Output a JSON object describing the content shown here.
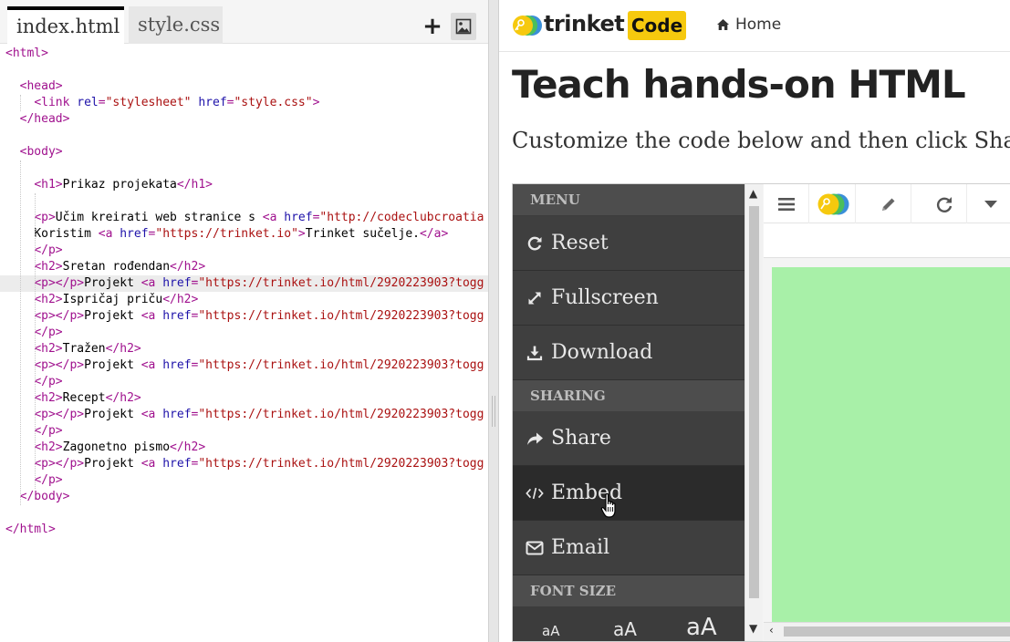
{
  "editor": {
    "tabs": [
      {
        "label": "index.html",
        "active": true
      },
      {
        "label": "style.css",
        "active": false
      }
    ],
    "add_file_icon": "plus-icon",
    "image_icon": "image-icon"
  },
  "code": {
    "lines": [
      [
        [
          "tg",
          "<html>"
        ]
      ],
      [],
      [
        [
          "tx",
          "  "
        ],
        [
          "tg",
          "<head>"
        ]
      ],
      [
        [
          "tx",
          "    "
        ],
        [
          "tg",
          "<link "
        ],
        [
          "at",
          "rel"
        ],
        [
          "tg",
          "="
        ],
        [
          "st",
          "\"stylesheet\""
        ],
        [
          "tx",
          " "
        ],
        [
          "at",
          "href"
        ],
        [
          "tg",
          "="
        ],
        [
          "st",
          "\"style.css\""
        ],
        [
          "tg",
          ">"
        ]
      ],
      [
        [
          "tx",
          "  "
        ],
        [
          "tg",
          "</head>"
        ]
      ],
      [],
      [
        [
          "tx",
          "  "
        ],
        [
          "tg",
          "<body>"
        ]
      ],
      [],
      [
        [
          "tx",
          "    "
        ],
        [
          "tg",
          "<h1>"
        ],
        [
          "tx",
          "Prikaz projekata"
        ],
        [
          "tg",
          "</h1>"
        ]
      ],
      [],
      [
        [
          "tx",
          "    "
        ],
        [
          "tg",
          "<p>"
        ],
        [
          "tx",
          "Učim kreirati web stranice s "
        ],
        [
          "tg",
          "<a "
        ],
        [
          "at",
          "href"
        ],
        [
          "tg",
          "="
        ],
        [
          "st",
          "\"http://codeclubcroatia"
        ]
      ],
      [
        [
          "tx",
          "    Koristim "
        ],
        [
          "tg",
          "<a "
        ],
        [
          "at",
          "href"
        ],
        [
          "tg",
          "="
        ],
        [
          "st",
          "\"https://trinket.io\""
        ],
        [
          "tg",
          ">"
        ],
        [
          "tx",
          "Trinket sučelje."
        ],
        [
          "tg",
          "</a>"
        ]
      ],
      [
        [
          "tx",
          "    "
        ],
        [
          "tg",
          "</p>"
        ]
      ],
      [
        [
          "tx",
          "    "
        ],
        [
          "tg",
          "<h2>"
        ],
        [
          "tx",
          "Sretan rođendan"
        ],
        [
          "tg",
          "</h2>"
        ]
      ],
      [
        [
          "tx",
          "    "
        ],
        [
          "tg",
          "<p></p>"
        ],
        [
          "tx",
          "Projekt "
        ],
        [
          "tg",
          "<a "
        ],
        [
          "at",
          "href"
        ],
        [
          "tg",
          "="
        ],
        [
          "st",
          "\"https://trinket.io/html/2920223903?togg"
        ]
      ],
      [
        [
          "tx",
          "    "
        ],
        [
          "tg",
          "<h2>"
        ],
        [
          "tx",
          "Ispričaj priču"
        ],
        [
          "tg",
          "</h2>"
        ]
      ],
      [
        [
          "tx",
          "    "
        ],
        [
          "tg",
          "<p></p>"
        ],
        [
          "tx",
          "Projekt "
        ],
        [
          "tg",
          "<a "
        ],
        [
          "at",
          "href"
        ],
        [
          "tg",
          "="
        ],
        [
          "st",
          "\"https://trinket.io/html/2920223903?togg"
        ]
      ],
      [
        [
          "tx",
          "    "
        ],
        [
          "tg",
          "</p>"
        ]
      ],
      [
        [
          "tx",
          "    "
        ],
        [
          "tg",
          "<h2>"
        ],
        [
          "tx",
          "Tražen"
        ],
        [
          "tg",
          "</h2>"
        ]
      ],
      [
        [
          "tx",
          "    "
        ],
        [
          "tg",
          "<p></p>"
        ],
        [
          "tx",
          "Projekt "
        ],
        [
          "tg",
          "<a "
        ],
        [
          "at",
          "href"
        ],
        [
          "tg",
          "="
        ],
        [
          "st",
          "\"https://trinket.io/html/2920223903?togg"
        ]
      ],
      [
        [
          "tx",
          "    "
        ],
        [
          "tg",
          "</p>"
        ]
      ],
      [
        [
          "tx",
          "    "
        ],
        [
          "tg",
          "<h2>"
        ],
        [
          "tx",
          "Recept"
        ],
        [
          "tg",
          "</h2>"
        ]
      ],
      [
        [
          "tx",
          "    "
        ],
        [
          "tg",
          "<p></p>"
        ],
        [
          "tx",
          "Projekt "
        ],
        [
          "tg",
          "<a "
        ],
        [
          "at",
          "href"
        ],
        [
          "tg",
          "="
        ],
        [
          "st",
          "\"https://trinket.io/html/2920223903?togg"
        ]
      ],
      [
        [
          "tx",
          "    "
        ],
        [
          "tg",
          "</p>"
        ]
      ],
      [
        [
          "tx",
          "    "
        ],
        [
          "tg",
          "<h2>"
        ],
        [
          "tx",
          "Zagonetno pismo"
        ],
        [
          "tg",
          "</h2>"
        ]
      ],
      [
        [
          "tx",
          "    "
        ],
        [
          "tg",
          "<p></p>"
        ],
        [
          "tx",
          "Projekt "
        ],
        [
          "tg",
          "<a "
        ],
        [
          "at",
          "href"
        ],
        [
          "tg",
          "="
        ],
        [
          "st",
          "\"https://trinket.io/html/2920223903?togg"
        ]
      ],
      [
        [
          "tx",
          "    "
        ],
        [
          "tg",
          "</p>"
        ]
      ],
      [
        [
          "tx",
          "  "
        ],
        [
          "tg",
          "</body>"
        ]
      ],
      [],
      [
        [
          "tg",
          "</html>"
        ]
      ]
    ],
    "current_line": 14
  },
  "preview": {
    "brand": "trinket",
    "badge": "Code",
    "home_label": "Home",
    "home_icon": "home-icon",
    "heading": "Teach hands-on HTML",
    "subheading": "Customize the code below and then click Shar"
  },
  "trinket_menu": {
    "sections": {
      "menu": "MENU",
      "sharing": "SHARING",
      "font_size": "FONT SIZE"
    },
    "items": [
      {
        "label": "Reset",
        "icon": "refresh-icon"
      },
      {
        "label": "Fullscreen",
        "icon": "expand-icon"
      },
      {
        "label": "Download",
        "icon": "download-icon"
      },
      {
        "label": "Share",
        "icon": "share-icon"
      },
      {
        "label": "Embed",
        "icon": "code-icon"
      },
      {
        "label": "Email",
        "icon": "envelope-icon"
      }
    ],
    "font_sizes": [
      "aA",
      "aA",
      "aA"
    ]
  },
  "output_toolbar": {
    "icons": [
      "menu-icon",
      "trinket-logo-icon",
      "pencil-icon",
      "reload-icon",
      "caret-down-icon"
    ]
  },
  "colors": {
    "output_background": "#a8f0a8",
    "badge_yellow": "#f6c90e",
    "menu_dark": "#3f3f3f"
  }
}
